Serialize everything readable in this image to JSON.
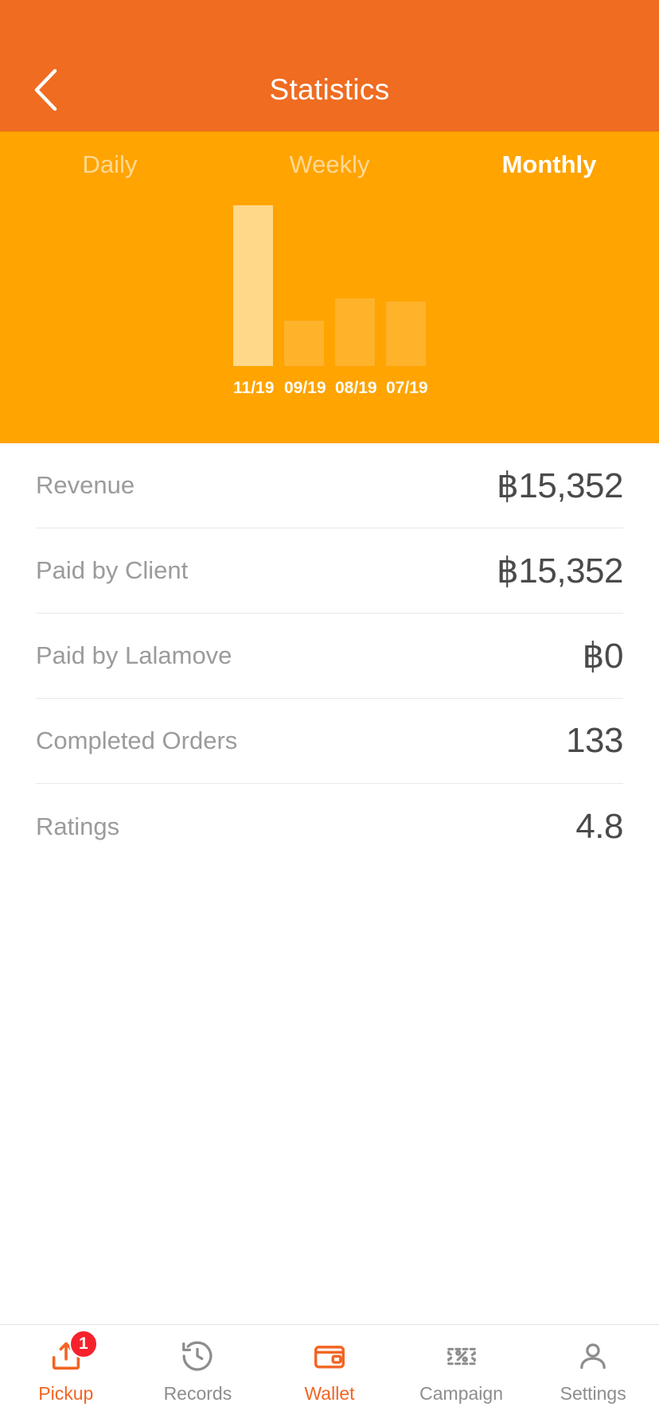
{
  "header": {
    "title": "Statistics",
    "back_icon": "chevron-left-icon",
    "bg_color": "#ef6c21"
  },
  "tabs": {
    "items": [
      {
        "label": "Daily",
        "active": false
      },
      {
        "label": "Weekly",
        "active": false
      },
      {
        "label": "Monthly",
        "active": true
      }
    ],
    "bg_color": "#ffa400"
  },
  "chart_data": {
    "type": "bar",
    "title": "",
    "xlabel": "",
    "ylabel": "",
    "categories": [
      "11/19",
      "09/19",
      "08/19",
      "07/19"
    ],
    "values": [
      15352,
      4200,
      6400,
      6100
    ],
    "bar_height_pct": [
      100,
      28,
      42,
      40
    ],
    "selected_index": 0,
    "selected_color": "#ffd989",
    "bar_color": "rgba(255,255,255,0.17)",
    "grid": false,
    "legend": "none",
    "ylim": [
      0,
      15352
    ]
  },
  "stats": {
    "rows": [
      {
        "label": "Revenue",
        "value": "฿15,352"
      },
      {
        "label": "Paid by Client",
        "value": "฿15,352"
      },
      {
        "label": "Paid by Lalamove",
        "value": "฿0"
      },
      {
        "label": "Completed Orders",
        "value": "133"
      },
      {
        "label": "Ratings",
        "value": "4.8"
      }
    ]
  },
  "bottom_nav": {
    "active_color": "#f26522",
    "inactive_color": "#8d8d8d",
    "items": [
      {
        "label": "Pickup",
        "icon": "upload-box-icon",
        "active": true,
        "badge": "1"
      },
      {
        "label": "Records",
        "icon": "clock-history-icon",
        "active": false,
        "badge": ""
      },
      {
        "label": "Wallet",
        "icon": "wallet-icon",
        "active": true,
        "badge": ""
      },
      {
        "label": "Campaign",
        "icon": "coupon-ticket-icon",
        "active": false,
        "badge": ""
      },
      {
        "label": "Settings",
        "icon": "person-icon",
        "active": false,
        "badge": ""
      }
    ]
  }
}
